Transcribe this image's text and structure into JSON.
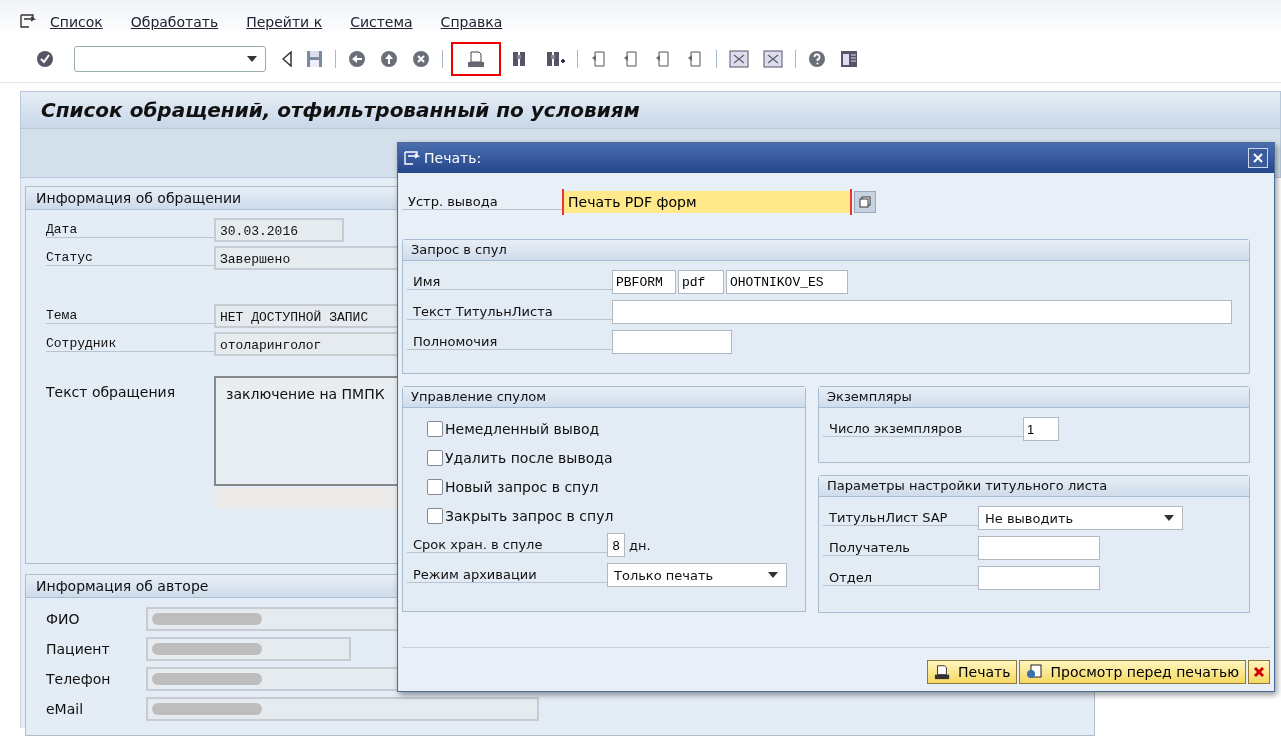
{
  "menu_bar": {
    "items": [
      {
        "label": "Список"
      },
      {
        "label": "Обработать"
      },
      {
        "label": "Перейти к"
      },
      {
        "label": "Система"
      },
      {
        "label": "Справка"
      }
    ]
  },
  "toolbar": {
    "icons": [
      {
        "kind": "enter",
        "highlighted": false
      },
      {
        "kind": "command"
      },
      {
        "kind": "triangle",
        "highlighted": false
      },
      {
        "kind": "save",
        "highlighted": false
      },
      {
        "kind": "separator"
      },
      {
        "kind": "back",
        "highlighted": false
      },
      {
        "kind": "exit",
        "highlighted": false
      },
      {
        "kind": "cancel",
        "highlighted": false
      },
      {
        "kind": "separator"
      },
      {
        "kind": "print",
        "highlighted": true
      },
      {
        "kind": "find",
        "highlighted": false
      },
      {
        "kind": "find_next",
        "highlighted": false
      },
      {
        "kind": "separator"
      },
      {
        "kind": "page",
        "highlighted": false
      },
      {
        "kind": "page",
        "highlighted": false
      },
      {
        "kind": "page",
        "highlighted": false
      },
      {
        "kind": "page",
        "highlighted": false
      },
      {
        "kind": "separator"
      },
      {
        "kind": "window",
        "highlighted": false
      },
      {
        "kind": "window",
        "highlighted": false
      },
      {
        "kind": "separator"
      },
      {
        "kind": "help",
        "highlighted": false
      },
      {
        "kind": "layout",
        "highlighted": false
      }
    ]
  },
  "screen_title": "Список обращений, отфильтрованный по условиям",
  "request_info": {
    "title": "Информация об обращении",
    "fields": [
      {
        "label": "Дата",
        "value": "30.03.2016",
        "kind": "short"
      },
      {
        "label": "Статус",
        "value": "Завершено",
        "kind": "long"
      },
      {
        "label": "Тема",
        "value": "НЕТ ДОСТУПНОЙ ЗАПИС",
        "kind": "long"
      },
      {
        "label": "Сотрудник",
        "value": "отоларинголог",
        "kind": "long"
      }
    ],
    "text_label": "Текст обращения",
    "text_value": "заключение на ПМПК"
  },
  "author_info": {
    "title": "Информация об авторе",
    "fields": [
      {
        "label": "ФИО",
        "redacted": true
      },
      {
        "label": "Пациент",
        "redacted": true
      },
      {
        "label": "Телефон",
        "redacted": true
      },
      {
        "label": "eMail",
        "redacted": true
      }
    ]
  },
  "print_dialog": {
    "title": "Печать:",
    "output_device": {
      "label": "Устр. вывода",
      "value": "Печать PDF форм"
    },
    "spool_request": {
      "title": "Запрос в спул",
      "name_label": "Имя",
      "name_parts": [
        "PBFORM",
        "pdf",
        "OHOTNIKOV_ES"
      ],
      "cover_text_label": "Текст ТитульнЛиста",
      "authorization_label": "Полномочия"
    },
    "spool_control": {
      "title": "Управление спулом",
      "options": [
        {
          "label": "Немедленный вывод",
          "checked": false
        },
        {
          "label": "Удалить после вывода",
          "checked": false
        },
        {
          "label": "Новый запрос в спул",
          "checked": false
        },
        {
          "label": "Закрыть запрос в спул",
          "checked": false
        }
      ],
      "retention_label": "Срок хран. в спуле",
      "retention_value": "8",
      "retention_unit": "дн.",
      "archive_label": "Режим архивации",
      "archive_value": "Только печать"
    },
    "copies": {
      "title": "Экземпляры",
      "label": "Число экземпляров",
      "value": "1"
    },
    "cover_sheet": {
      "title": "Параметры настройки титульного листа",
      "sap_label": "ТитульнЛист SAP",
      "sap_value": "Не выводить",
      "recipient_label": "Получатель",
      "department_label": "Отдел"
    },
    "buttons": [
      {
        "kind": "print",
        "label": "Печать"
      },
      {
        "kind": "preview",
        "label": "Просмотр перед печатью"
      },
      {
        "kind": "cancel"
      }
    ]
  }
}
